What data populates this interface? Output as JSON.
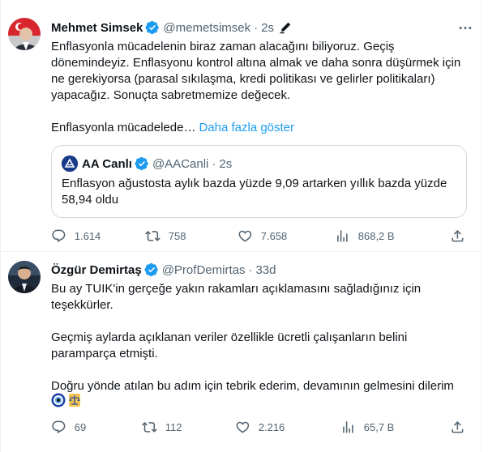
{
  "tweets": [
    {
      "author": "Mehmet Simsek",
      "handle": "@memetsimsek",
      "separator": "·",
      "time": "2s",
      "text": "Enflasyonla mücadelenin biraz zaman alacağını biliyoruz. Geçiş dönemindeyiz. Enflasyonu kontrol altına almak ve daha sonra düşürmek için ne gerekiyorsa (parasal sıkılaşma, kredi politikası ve gelirler politikaları) yapacağız. Sonuçta sabretmemize değecek.",
      "text_line2": "Enflasyonla mücadelede…",
      "show_more": "Daha fazla göster",
      "quote": {
        "author": "AA Canlı",
        "handle": "@AACanli",
        "separator": "·",
        "time": "2s",
        "text": "Enflasyon ağustosta aylık bazda yüzde 9,09 artarken yıllık bazda yüzde 58,94 oldu"
      },
      "stats": {
        "replies": "1.614",
        "retweets": "758",
        "likes": "7.658",
        "views": "868,2 B"
      }
    },
    {
      "author": "Özgür Demirtaş",
      "handle": "@ProfDemirtas",
      "separator": "·",
      "time": "33d",
      "paragraphs": [
        "Bu ay TUIK'in gerçeğe yakın rakamları açıklamasını sağladığınız için teşekkürler.",
        "Geçmiş aylarda açıklanan veriler özellikle ücretli çalışanların belini paramparça etmişti.",
        "Doğru yönde atılan bu adım için tebrik ederim, devamının gelmesini dilerim"
      ],
      "emojis": [
        "nazar-amulet",
        "scales-of-justice"
      ],
      "stats": {
        "replies": "69",
        "retweets": "112",
        "likes": "2.216",
        "views": "65,7 B"
      }
    }
  ],
  "colors": {
    "accent": "#1d9bf0",
    "secondary_text": "#536471",
    "border": "#cfd9de",
    "verified": "#1d9bf0"
  }
}
